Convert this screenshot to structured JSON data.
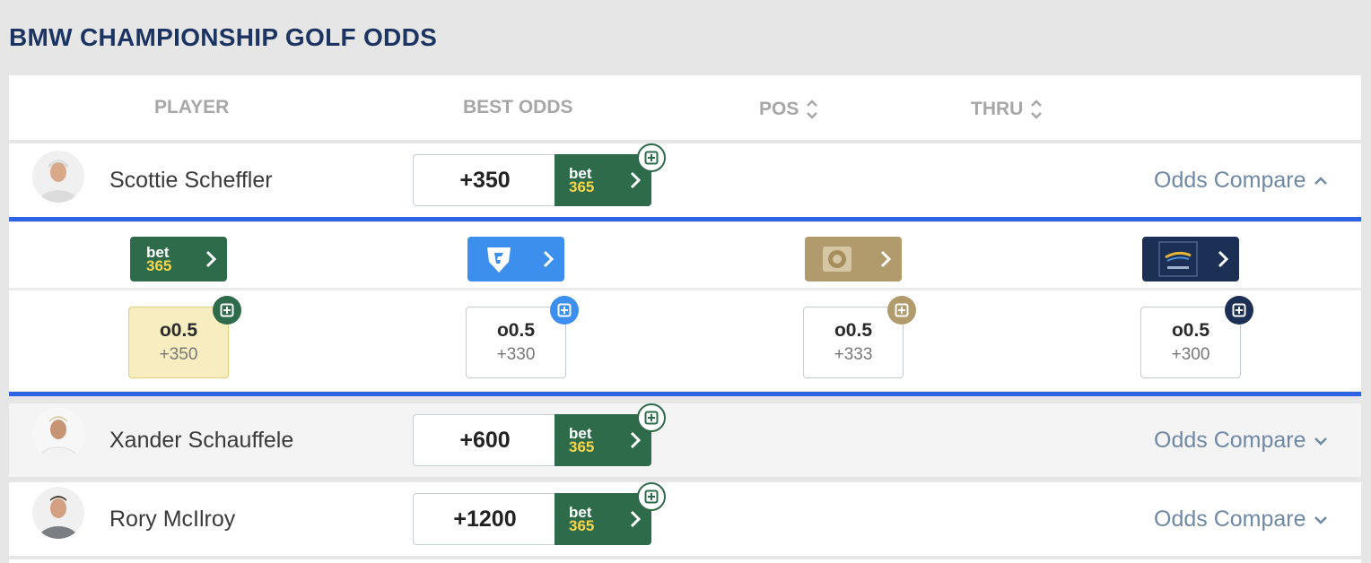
{
  "page": {
    "title": "BMW CHAMPIONSHIP GOLF ODDS"
  },
  "columns": {
    "player": "PLAYER",
    "best_odds": "BEST ODDS",
    "pos": "POS",
    "thru": "THRU"
  },
  "players": [
    {
      "name": "Scottie Scheffler",
      "best_odds": "+350",
      "book": "bet365",
      "compare_label": "Odds Compare",
      "expanded": true
    },
    {
      "name": "Xander Schauffele",
      "best_odds": "+600",
      "book": "bet365",
      "compare_label": "Odds Compare",
      "expanded": false
    },
    {
      "name": "Rory McIlroy",
      "best_odds": "+1200",
      "book": "bet365",
      "compare_label": "Odds Compare",
      "expanded": false
    }
  ],
  "bet365_logo": {
    "line1": "bet",
    "line2": "365"
  },
  "compare": {
    "books": [
      {
        "name": "bet365",
        "color": "#2e6b4a",
        "line": "o0.5",
        "price": "+350",
        "best": true
      },
      {
        "name": "fanduel",
        "color": "#3d8fee",
        "line": "o0.5",
        "price": "+330",
        "best": false
      },
      {
        "name": "betmgm",
        "color": "#b19a6c",
        "line": "o0.5",
        "price": "+333",
        "best": false
      },
      {
        "name": "betrivers",
        "color": "#1c2f55",
        "line": "o0.5",
        "price": "+300",
        "best": false
      }
    ]
  },
  "colors": {
    "title": "#1b3461",
    "accent_blue": "#2e63e6",
    "bet365_green": "#2e6b4a",
    "bet365_yellow": "#f6d64a",
    "best_highlight": "#f7edc0"
  }
}
